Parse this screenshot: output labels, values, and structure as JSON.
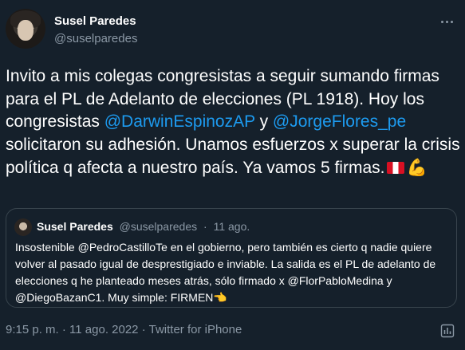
{
  "author": {
    "display_name": "Susel Paredes",
    "handle": "@suselparedes"
  },
  "tweet": {
    "text_1": "Invito a mis colegas congresistas a seguir sumando firmas para el PL de Adelanto de elecciones (PL 1918). Hoy los congresistas ",
    "mention_1": "@DarwinEspinozAP",
    "text_2": " y ",
    "mention_2": "@JorgeFlores_pe",
    "text_3": " solicitaron su adhesión. Unamos esfuerzos x superar la crisis política q afecta a nuestro país. Ya vamos 5 firmas.",
    "emoji_flag": "peru-flag-emoji",
    "emoji_muscle": "💪"
  },
  "quoted_tweet": {
    "display_name": "Susel Paredes",
    "handle": "@suselparedes",
    "separator": "·",
    "date": "11 ago.",
    "text": "Insostenible @PedroCastilloTe en el gobierno, pero también es cierto q nadie quiere volver al pasado igual de desprestigiado e inviable. La salida es el PL de adelanto de elecciones q he planteado meses atrás, sólo firmado x @FlorPabloMedina y @DiegoBazanC1. Muy simple: FIRMEN",
    "emoji": "👈"
  },
  "footer": {
    "time": "9:15 p. m.",
    "separator_1": "·",
    "date": "11 ago. 2022",
    "separator_2": "·",
    "source": "Twitter for iPhone"
  },
  "icons": {
    "more": "more-horizontal-icon",
    "analytics": "analytics-icon"
  },
  "colors": {
    "background": "#15202b",
    "text": "#ffffff",
    "muted": "#8b98a5",
    "link": "#1d9bf0",
    "border": "#38444d"
  }
}
